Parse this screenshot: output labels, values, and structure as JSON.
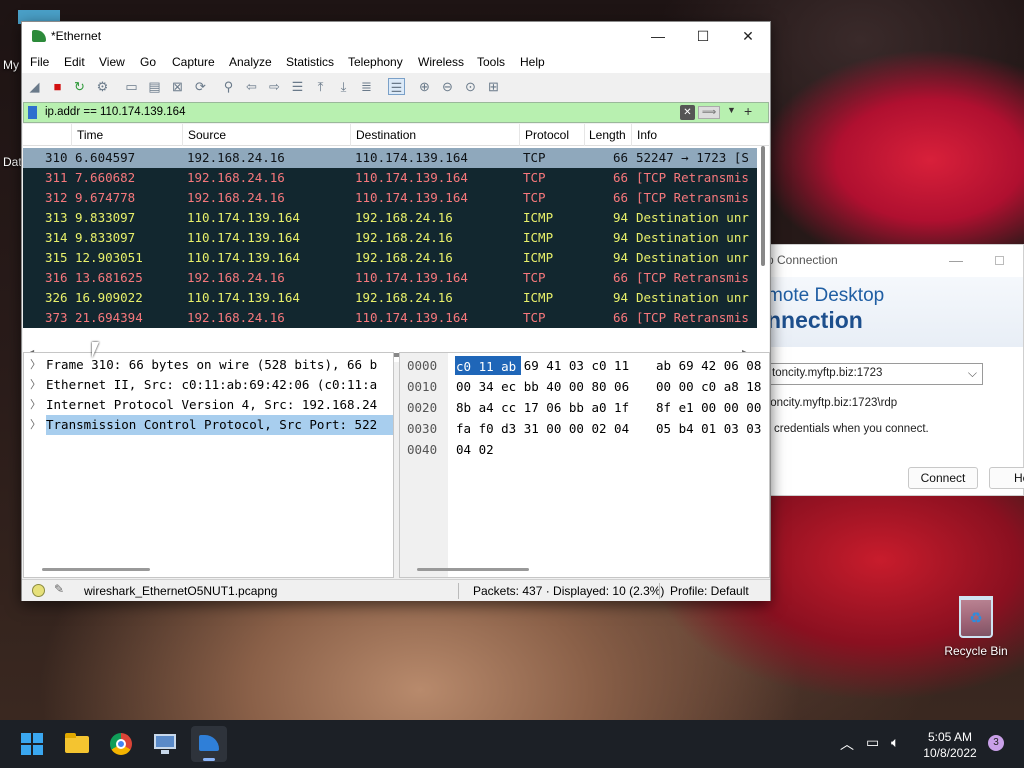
{
  "desktop": {
    "icon_partial_1": "My",
    "icon_partial_2": "Dat",
    "recycle_bin": "Recycle Bin"
  },
  "rdp": {
    "title": "p Connection",
    "header_line1": "mote Desktop",
    "header_line2": "nnection",
    "computer_value": "toncity.myftp.biz:1723",
    "computer_sub": "toncity.myftp.biz:1723\\rdp",
    "note": "r credentials when you connect.",
    "connect": "Connect",
    "help": "He"
  },
  "wireshark": {
    "title": "*Ethernet",
    "menu": [
      "File",
      "Edit",
      "View",
      "Go",
      "Capture",
      "Analyze",
      "Statistics",
      "Telephony",
      "Wireless",
      "Tools",
      "Help"
    ],
    "filter_value": "ip.addr == 110.174.139.164",
    "columns": [
      "Time",
      "Source",
      "Destination",
      "Protocol",
      "Length",
      "Info"
    ],
    "packets": [
      {
        "no": "310",
        "time": "6.604597",
        "src": "192.168.24.16",
        "dst": "110.174.139.164",
        "proto": "TCP",
        "len": "66",
        "info": "52247 → 1723 [S",
        "type": "tcp",
        "selected": true
      },
      {
        "no": "311",
        "time": "7.660682",
        "src": "192.168.24.16",
        "dst": "110.174.139.164",
        "proto": "TCP",
        "len": "66",
        "info": "[TCP Retransmis",
        "type": "tcp"
      },
      {
        "no": "312",
        "time": "9.674778",
        "src": "192.168.24.16",
        "dst": "110.174.139.164",
        "proto": "TCP",
        "len": "66",
        "info": "[TCP Retransmis",
        "type": "tcp"
      },
      {
        "no": "313",
        "time": "9.833097",
        "src": "110.174.139.164",
        "dst": "192.168.24.16",
        "proto": "ICMP",
        "len": "94",
        "info": "Destination unr",
        "type": "icmp"
      },
      {
        "no": "314",
        "time": "9.833097",
        "src": "110.174.139.164",
        "dst": "192.168.24.16",
        "proto": "ICMP",
        "len": "94",
        "info": "Destination unr",
        "type": "icmp"
      },
      {
        "no": "315",
        "time": "12.903051",
        "src": "110.174.139.164",
        "dst": "192.168.24.16",
        "proto": "ICMP",
        "len": "94",
        "info": "Destination unr",
        "type": "icmp"
      },
      {
        "no": "316",
        "time": "13.681625",
        "src": "192.168.24.16",
        "dst": "110.174.139.164",
        "proto": "TCP",
        "len": "66",
        "info": "[TCP Retransmis",
        "type": "tcp"
      },
      {
        "no": "326",
        "time": "16.909022",
        "src": "110.174.139.164",
        "dst": "192.168.24.16",
        "proto": "ICMP",
        "len": "94",
        "info": "Destination unr",
        "type": "icmp"
      },
      {
        "no": "373",
        "time": "21.694394",
        "src": "192.168.24.16",
        "dst": "110.174.139.164",
        "proto": "TCP",
        "len": "66",
        "info": "[TCP Retransmis",
        "type": "tcp"
      }
    ],
    "details": [
      "Frame 310: 66 bytes on wire (528 bits), 66 b",
      "Ethernet II, Src: c0:11:ab:69:42:06 (c0:11:a",
      "Internet Protocol Version 4, Src: 192.168.24",
      "Transmission Control Protocol, Src Port: 522"
    ],
    "hex": [
      {
        "off": "0000",
        "a": "c0 11 ab 69 41 03 c0 11",
        "b": "ab 69 42 06 08"
      },
      {
        "off": "0010",
        "a": "00 34 ec bb 40 00 80 06",
        "b": "00 00 c0 a8 18"
      },
      {
        "off": "0020",
        "a": "8b a4 cc 17 06 bb a0 1f",
        "b": "8f e1 00 00 00"
      },
      {
        "off": "0030",
        "a": "fa f0 d3 31 00 00 02 04",
        "b": "05 b4 01 03 03"
      },
      {
        "off": "0040",
        "a": "04 02",
        "b": ""
      }
    ],
    "hex_highlight": "c0 11 ab",
    "status_file": "wireshark_EthernetO5NUT1.pcapng",
    "status_packets": "Packets: 437 · Displayed: 10 (2.3%)",
    "status_profile": "Profile: Default"
  },
  "taskbar": {
    "time": "5:05 AM",
    "date": "10/8/2022",
    "notifications": "3"
  },
  "colors": {
    "tcp_row": "#f7787c",
    "icmp_row": "#e8f06a",
    "row_bg": "#12272f",
    "selected_row": "#8fa8bc"
  }
}
